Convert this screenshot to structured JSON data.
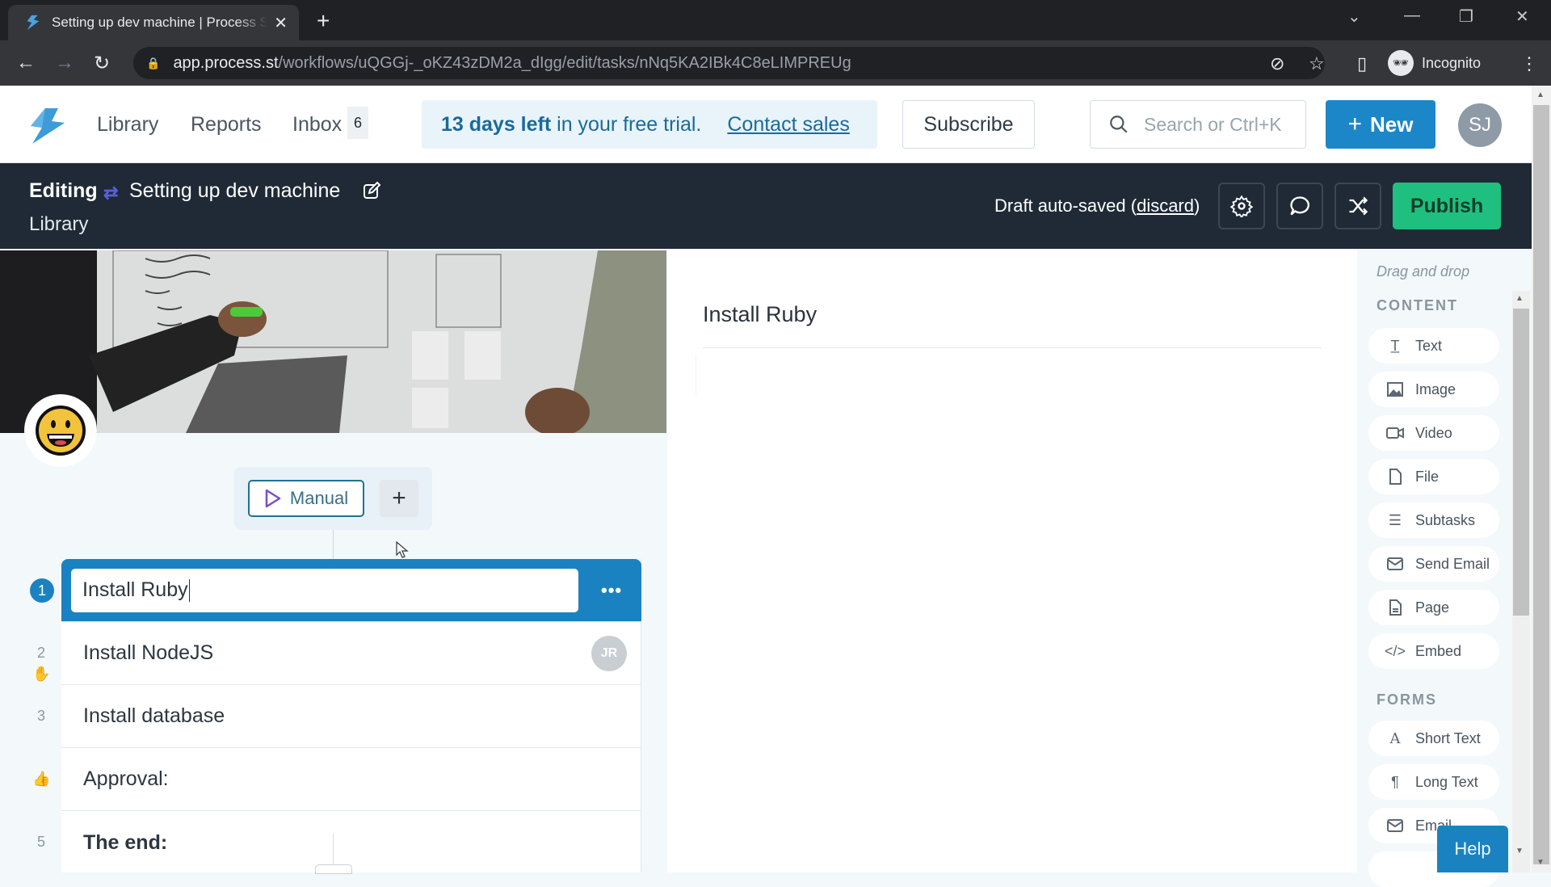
{
  "browser": {
    "tab_title": "Setting up dev machine | Process Street",
    "url_host": "app.process.st",
    "url_path": "/workflows/uQGGj-_oKZ43zDM2a_dIgg/edit/tasks/nNq5KA2IBk4C8eLIMPREUg",
    "profile_label": "Incognito"
  },
  "header": {
    "nav": [
      "Library",
      "Reports",
      "Inbox"
    ],
    "inbox_count": "6",
    "trial_bold": "13 days left",
    "trial_rest": " in your free trial.",
    "contact_sales": "Contact sales",
    "subscribe": "Subscribe",
    "search_placeholder": "Search or Ctrl+K",
    "new_label": "New",
    "user_initials": "SJ"
  },
  "editbar": {
    "mode": "Editing",
    "workflow_name": "Setting up dev machine",
    "breadcrumb": "Library",
    "draft_prefix": "Draft auto-saved (",
    "discard": "discard",
    "draft_suffix": ")",
    "publish": "Publish"
  },
  "trigger": {
    "manual_label": "Manual",
    "add_label": "+"
  },
  "tasks": [
    {
      "number": "1",
      "label": "Install Ruby",
      "active": true
    },
    {
      "number": "2",
      "label": "Install NodeJS",
      "assignee": "JR"
    },
    {
      "number": "3",
      "label": "Install database"
    },
    {
      "number": "",
      "label": "Approval:",
      "type": "approval"
    },
    {
      "number": "5",
      "label": "The end:",
      "bold": true
    }
  ],
  "content": {
    "task_title": "Install Ruby"
  },
  "sidebar": {
    "hint": "Drag and drop",
    "content_heading": "CONTENT",
    "content_items": [
      "Text",
      "Image",
      "Video",
      "File",
      "Subtasks",
      "Send Email",
      "Page",
      "Embed"
    ],
    "forms_heading": "FORMS",
    "forms_items": [
      "Short Text",
      "Long Text",
      "Email"
    ]
  },
  "help_label": "Help"
}
